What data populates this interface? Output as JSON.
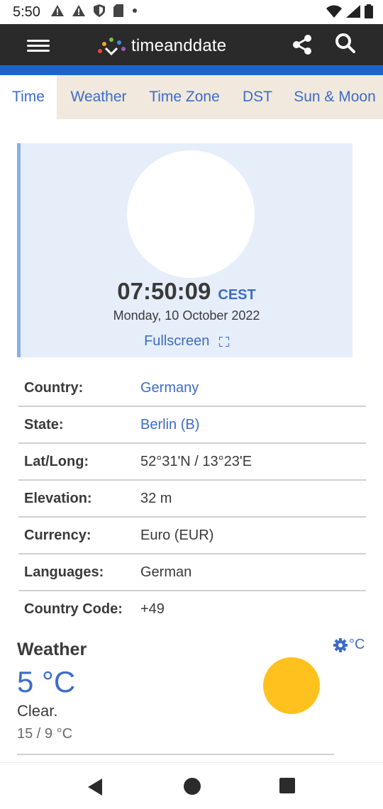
{
  "status_bar": {
    "time": "5:50",
    "icons": [
      "alert-icon",
      "alert-icon",
      "shield-icon",
      "sd-card-icon",
      "dot-icon",
      "wifi-icon",
      "signal-icon",
      "battery-icon"
    ]
  },
  "header": {
    "logo_text": "timeanddate",
    "menu_icon": "hamburger-icon",
    "share_icon": "share-icon",
    "search_icon": "search-icon",
    "bg_color": "#2a2a2a",
    "accent_color": "#1e63c9"
  },
  "tabs": [
    {
      "label": "Time",
      "active": true
    },
    {
      "label": "Weather",
      "active": false
    },
    {
      "label": "Time Zone",
      "active": false
    },
    {
      "label": "DST",
      "active": false
    },
    {
      "label": "Sun & Moon",
      "active": false
    }
  ],
  "clock": {
    "time": "07:50:09",
    "timezone": "CEST",
    "date": "Monday, 10 October 2022",
    "fullscreen_label": "Fullscreen"
  },
  "info": [
    {
      "label": "Country:",
      "value": "Germany",
      "link": true
    },
    {
      "label": "State:",
      "value": "Berlin (B)",
      "link": true
    },
    {
      "label": "Lat/Long:",
      "value": "52°31'N / 13°23'E",
      "link": false
    },
    {
      "label": "Elevation:",
      "value": "32 m",
      "link": false
    },
    {
      "label": "Currency:",
      "value": "Euro (EUR)",
      "link": false
    },
    {
      "label": "Languages:",
      "value": "German",
      "link": false
    },
    {
      "label": "Country Code:",
      "value": "+49",
      "link": false
    }
  ],
  "weather": {
    "title": "Weather",
    "unit_label": "°C",
    "temperature": "5 °C",
    "description": "Clear.",
    "range": "15 / 9 °C",
    "icon": "sun-icon",
    "sun_color": "#ffc11e"
  },
  "nav": {
    "back_icon": "back-icon",
    "home_icon": "home-icon",
    "recent_icon": "recent-apps-icon"
  }
}
